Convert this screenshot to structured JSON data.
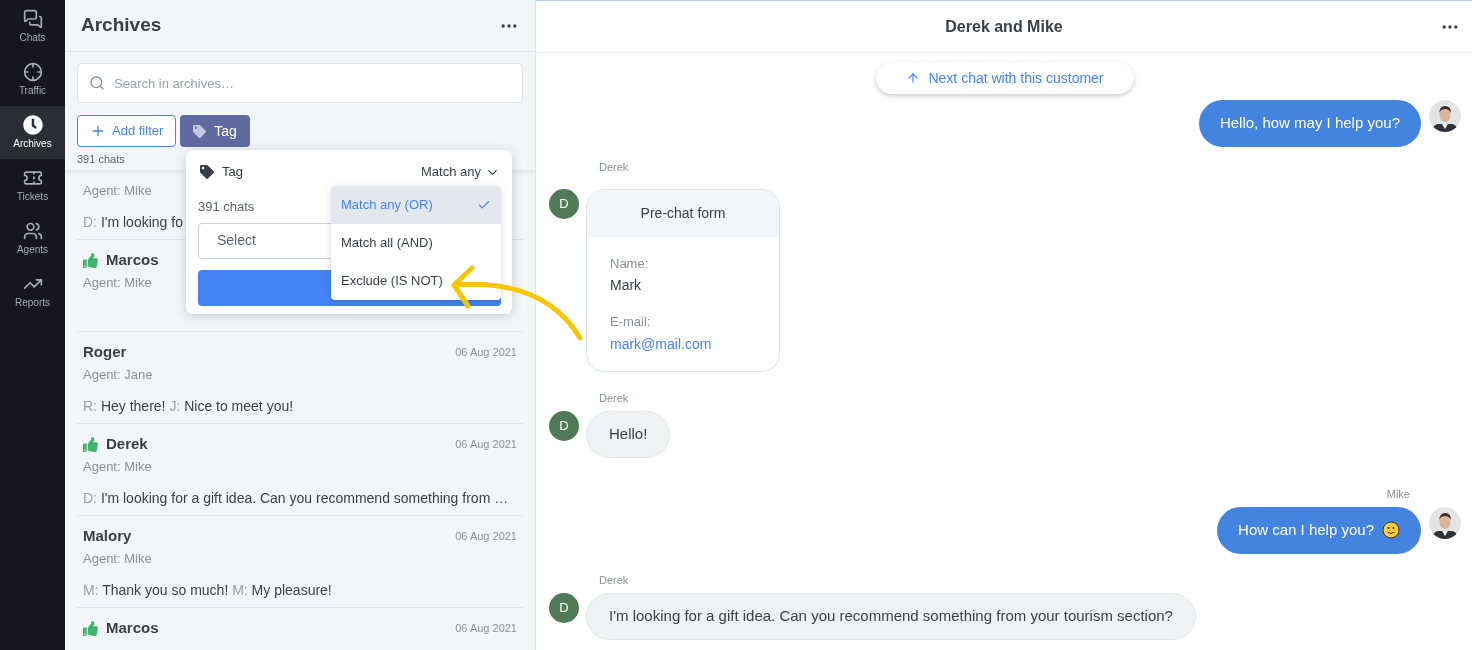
{
  "nav": [
    {
      "label": "Chats",
      "selected": false
    },
    {
      "label": "Traffic",
      "selected": false
    },
    {
      "label": "Archives",
      "selected": true
    },
    {
      "label": "Tickets",
      "selected": false
    },
    {
      "label": "Agents",
      "selected": false
    },
    {
      "label": "Reports",
      "selected": false
    }
  ],
  "archives": {
    "title": "Archives",
    "search": {
      "placeholder": "Search in archives…"
    },
    "add_filter": "Add filter",
    "tag_filter": "Tag",
    "count": "391 chats",
    "chats": [
      {
        "agent": "Agent: Mike",
        "preview": [
          {
            "who": "D:",
            "text": "I'm looking fo"
          }
        ]
      },
      {
        "name": "Marcos",
        "rated": true,
        "agent": "Agent: Mike"
      },
      {
        "name": "Roger",
        "rated": false,
        "date": "06 Aug 2021",
        "agent": "Agent: Jane",
        "preview": [
          {
            "who": "R:",
            "text": "Hey there!"
          },
          {
            "who": "J:",
            "text": "Nice to meet you!"
          }
        ]
      },
      {
        "name": "Derek",
        "rated": true,
        "date": "06 Aug 2021",
        "agent": "Agent: Mike",
        "preview": [
          {
            "who": "D:",
            "text": "I'm looking for a gift idea. Can you recommend something from …"
          }
        ]
      },
      {
        "name": "Malory",
        "rated": false,
        "date": "06 Aug 2021",
        "agent": "Agent: Mike",
        "preview": [
          {
            "who": "M:",
            "text": "Thank you so much!"
          },
          {
            "who": "M:",
            "text": "My pleasure!"
          }
        ]
      },
      {
        "name": "Marcos",
        "rated": true,
        "date": "06 Aug 2021"
      }
    ]
  },
  "popover": {
    "title": "Tag",
    "match": "Match any",
    "count": "391 chats",
    "select_placeholder": "Select",
    "options": [
      {
        "label": "Match any (OR)",
        "selected": true
      },
      {
        "label": "Match all (AND)",
        "selected": false
      },
      {
        "label": "Exclude (IS NOT)",
        "selected": false
      }
    ]
  },
  "chat": {
    "title": "Derek and Mike",
    "next_chat": "Next chat with this customer",
    "messages": [
      {
        "kind": "outgoing",
        "text": "Hello, how may I help you?",
        "emoji": false
      },
      {
        "kind": "form",
        "author": "Derek",
        "initial": "D",
        "title": "Pre-chat form",
        "fields": [
          {
            "label": "Name:",
            "value": "Mark",
            "link": false
          },
          {
            "label": "E-mail:",
            "value": "mark@mail.com",
            "link": true
          }
        ]
      },
      {
        "kind": "incoming",
        "author": "Derek",
        "initial": "D",
        "text": "Hello!"
      },
      {
        "kind": "outgoing",
        "author": "Mike",
        "text": "How can I help you?",
        "emoji": true
      },
      {
        "kind": "incoming",
        "author": "Derek",
        "initial": "D",
        "text": "I'm looking for a gift idea. Can you recommend something from your tourism section?"
      }
    ]
  }
}
